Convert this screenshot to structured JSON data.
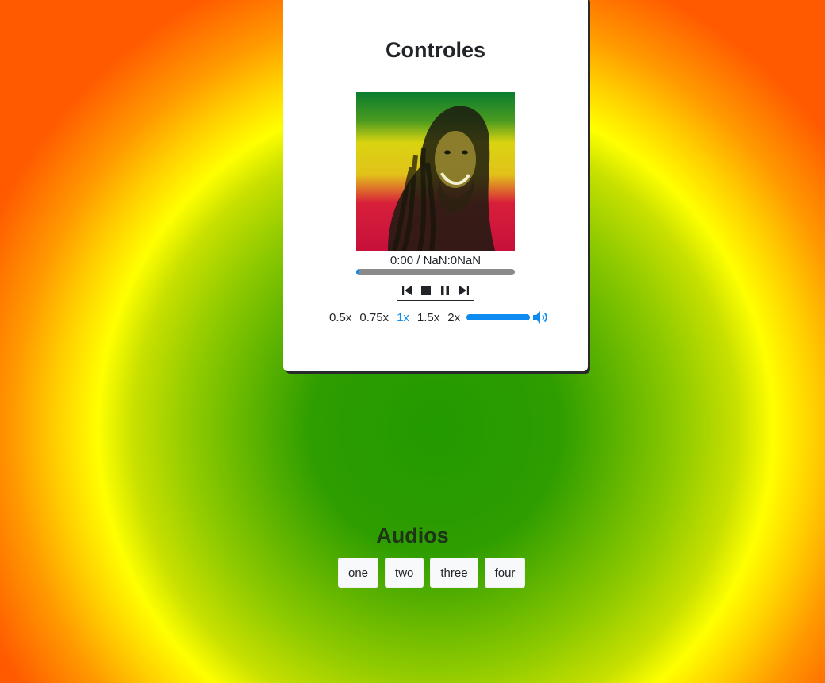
{
  "player": {
    "title": "Controles",
    "time_display": "0:00 / NaN:0NaN",
    "progress_fraction": 0.02,
    "volume_fraction": 1.0,
    "speeds": [
      {
        "label": "0.5x",
        "active": false
      },
      {
        "label": "0.75x",
        "active": false
      },
      {
        "label": "1x",
        "active": true
      },
      {
        "label": "1.5x",
        "active": false
      },
      {
        "label": "2x",
        "active": false
      }
    ],
    "controls": {
      "previous_icon": "skip-previous-icon",
      "stop_icon": "stop-icon",
      "pause_icon": "pause-icon",
      "next_icon": "skip-next-icon",
      "volume_icon": "volume-icon"
    },
    "accent_color": "#0d8bf0"
  },
  "audios": {
    "title": "Audios",
    "buttons": [
      "one",
      "two",
      "three",
      "four"
    ]
  }
}
